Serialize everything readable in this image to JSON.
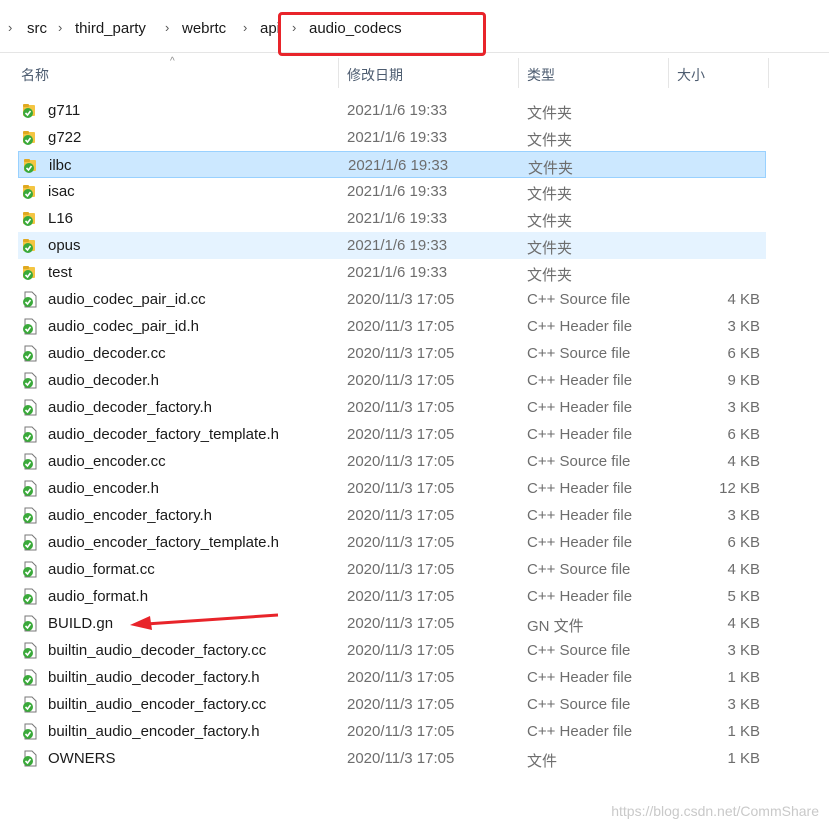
{
  "breadcrumb": {
    "items": [
      "src",
      "third_party",
      "webrtc",
      "api",
      "audio_codecs"
    ]
  },
  "columns": {
    "name": "名称",
    "modified": "修改日期",
    "type": "类型",
    "size": "大小"
  },
  "files": [
    {
      "name": "g711",
      "date": "2021/1/6 19:33",
      "type": "文件夹",
      "size": "",
      "kind": "folder"
    },
    {
      "name": "g722",
      "date": "2021/1/6 19:33",
      "type": "文件夹",
      "size": "",
      "kind": "folder"
    },
    {
      "name": "ilbc",
      "date": "2021/1/6 19:33",
      "type": "文件夹",
      "size": "",
      "kind": "folder"
    },
    {
      "name": "isac",
      "date": "2021/1/6 19:33",
      "type": "文件夹",
      "size": "",
      "kind": "folder"
    },
    {
      "name": "L16",
      "date": "2021/1/6 19:33",
      "type": "文件夹",
      "size": "",
      "kind": "folder"
    },
    {
      "name": "opus",
      "date": "2021/1/6 19:33",
      "type": "文件夹",
      "size": "",
      "kind": "folder"
    },
    {
      "name": "test",
      "date": "2021/1/6 19:33",
      "type": "文件夹",
      "size": "",
      "kind": "folder"
    },
    {
      "name": "audio_codec_pair_id.cc",
      "date": "2020/11/3 17:05",
      "type": "C++ Source file",
      "size": "4 KB",
      "kind": "source"
    },
    {
      "name": "audio_codec_pair_id.h",
      "date": "2020/11/3 17:05",
      "type": "C++ Header file",
      "size": "3 KB",
      "kind": "header"
    },
    {
      "name": "audio_decoder.cc",
      "date": "2020/11/3 17:05",
      "type": "C++ Source file",
      "size": "6 KB",
      "kind": "source"
    },
    {
      "name": "audio_decoder.h",
      "date": "2020/11/3 17:05",
      "type": "C++ Header file",
      "size": "9 KB",
      "kind": "header"
    },
    {
      "name": "audio_decoder_factory.h",
      "date": "2020/11/3 17:05",
      "type": "C++ Header file",
      "size": "3 KB",
      "kind": "header"
    },
    {
      "name": "audio_decoder_factory_template.h",
      "date": "2020/11/3 17:05",
      "type": "C++ Header file",
      "size": "6 KB",
      "kind": "header"
    },
    {
      "name": "audio_encoder.cc",
      "date": "2020/11/3 17:05",
      "type": "C++ Source file",
      "size": "4 KB",
      "kind": "source"
    },
    {
      "name": "audio_encoder.h",
      "date": "2020/11/3 17:05",
      "type": "C++ Header file",
      "size": "12 KB",
      "kind": "header"
    },
    {
      "name": "audio_encoder_factory.h",
      "date": "2020/11/3 17:05",
      "type": "C++ Header file",
      "size": "3 KB",
      "kind": "header"
    },
    {
      "name": "audio_encoder_factory_template.h",
      "date": "2020/11/3 17:05",
      "type": "C++ Header file",
      "size": "6 KB",
      "kind": "header"
    },
    {
      "name": "audio_format.cc",
      "date": "2020/11/3 17:05",
      "type": "C++ Source file",
      "size": "4 KB",
      "kind": "source"
    },
    {
      "name": "audio_format.h",
      "date": "2020/11/3 17:05",
      "type": "C++ Header file",
      "size": "5 KB",
      "kind": "header"
    },
    {
      "name": "BUILD.gn",
      "date": "2020/11/3 17:05",
      "type": "GN 文件",
      "size": "4 KB",
      "kind": "gn"
    },
    {
      "name": "builtin_audio_decoder_factory.cc",
      "date": "2020/11/3 17:05",
      "type": "C++ Source file",
      "size": "3 KB",
      "kind": "source"
    },
    {
      "name": "builtin_audio_decoder_factory.h",
      "date": "2020/11/3 17:05",
      "type": "C++ Header file",
      "size": "1 KB",
      "kind": "header"
    },
    {
      "name": "builtin_audio_encoder_factory.cc",
      "date": "2020/11/3 17:05",
      "type": "C++ Source file",
      "size": "3 KB",
      "kind": "source"
    },
    {
      "name": "builtin_audio_encoder_factory.h",
      "date": "2020/11/3 17:05",
      "type": "C++ Header file",
      "size": "1 KB",
      "kind": "header"
    },
    {
      "name": "OWNERS",
      "date": "2020/11/3 17:05",
      "type": "文件",
      "size": "1 KB",
      "kind": "plain"
    }
  ],
  "selected_item": "ilbc",
  "hover_item": "opus",
  "watermark": "https://blog.csdn.net/CommShare",
  "colors": {
    "selection": "#cce8ff",
    "hover": "#e5f3ff",
    "annotation": "#e8242a",
    "folder": "#f4c542",
    "check": "#3aa93a"
  }
}
